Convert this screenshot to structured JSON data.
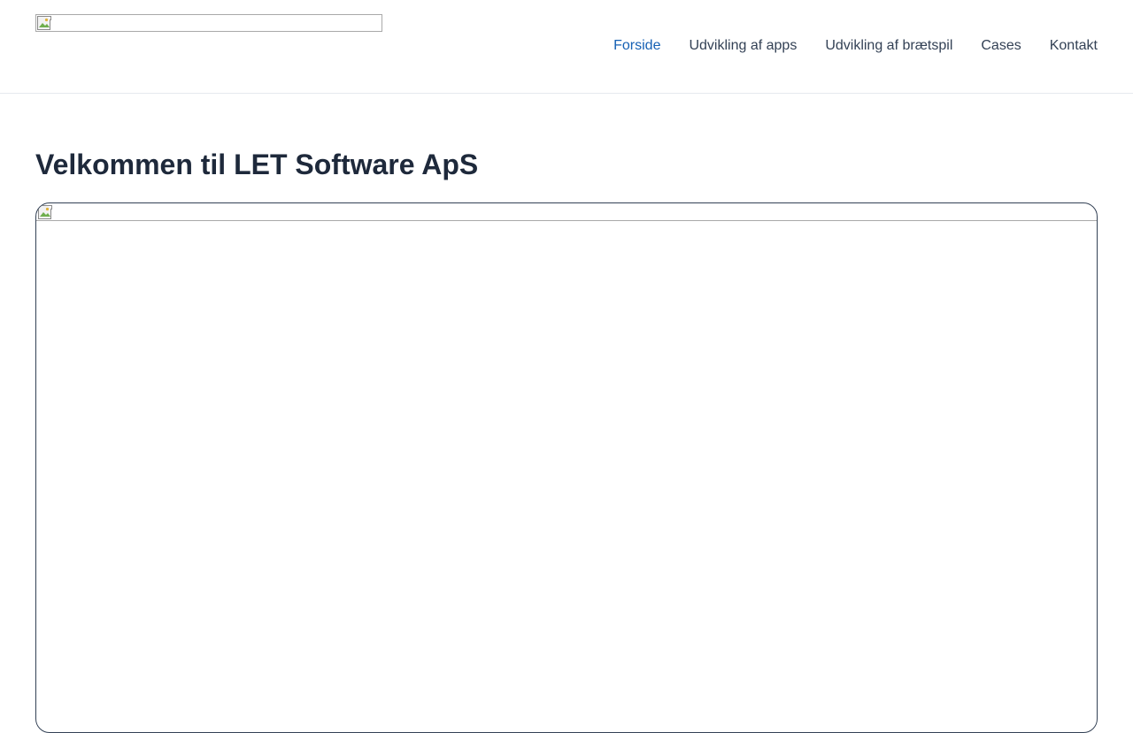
{
  "nav": {
    "items": [
      {
        "label": "Forside",
        "active": true
      },
      {
        "label": "Udvikling af apps",
        "active": false
      },
      {
        "label": "Udvikling af brætspil",
        "active": false
      },
      {
        "label": "Cases",
        "active": false
      },
      {
        "label": "Kontakt",
        "active": false
      }
    ]
  },
  "main": {
    "title": "Velkommen til LET Software ApS"
  },
  "colors": {
    "active_link": "#1560b4",
    "nav_link": "#334155",
    "heading": "#1e293b",
    "divider": "#e6e9ee"
  },
  "icons": {
    "logo": "broken-image-icon",
    "hero": "broken-image-icon"
  }
}
